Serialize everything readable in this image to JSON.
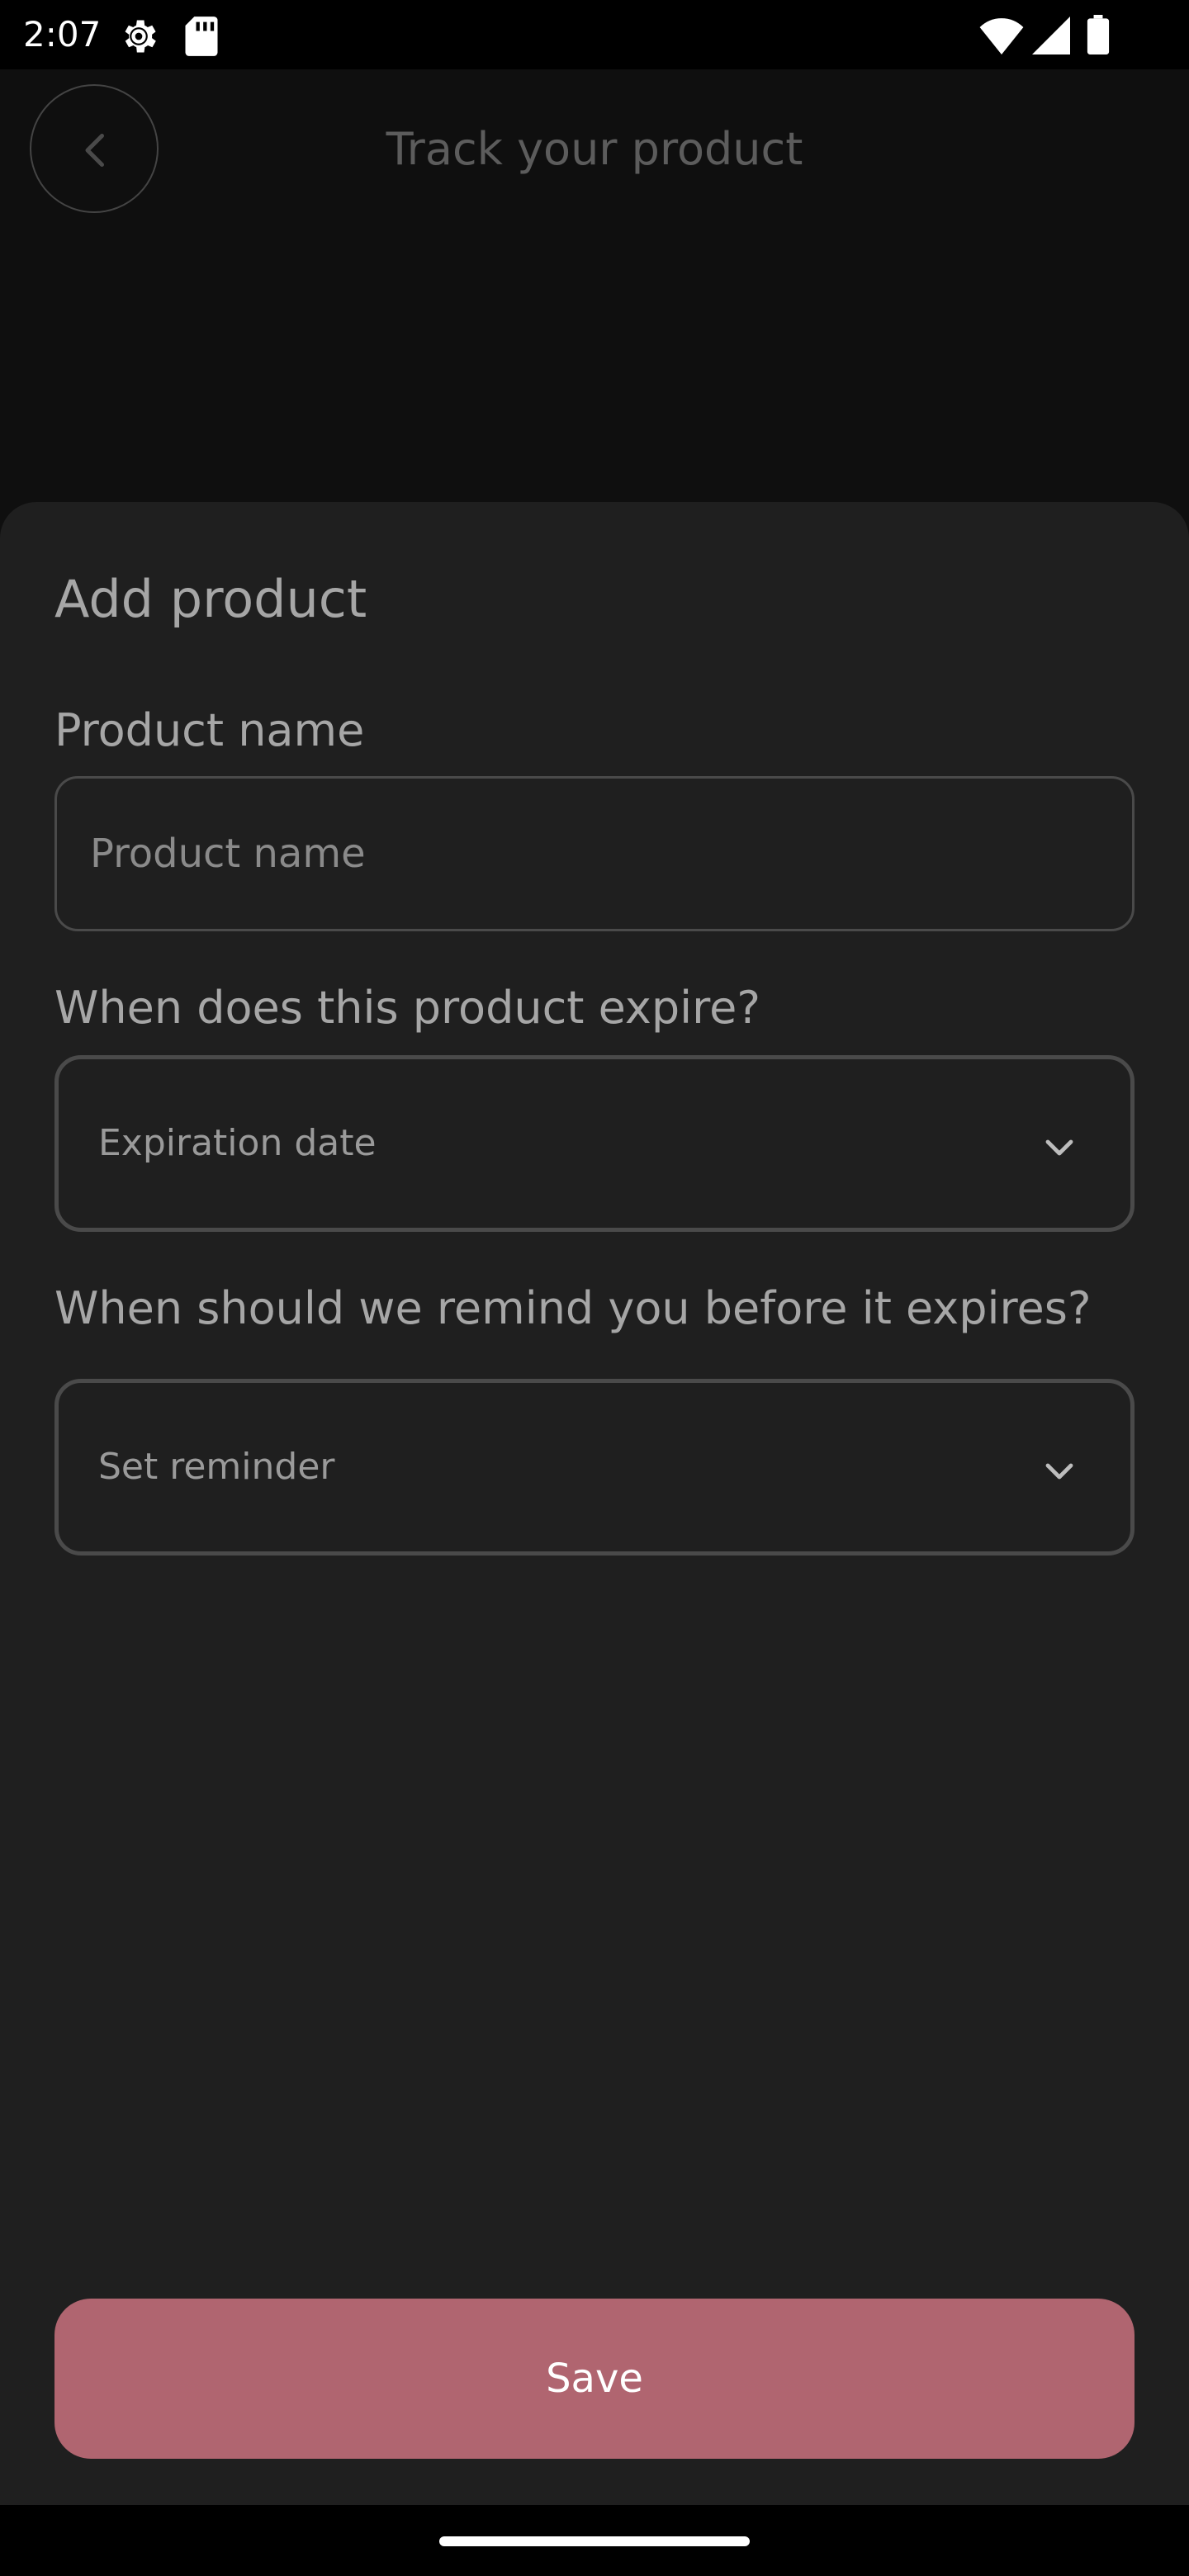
{
  "status_bar": {
    "time": "2:07",
    "icons": [
      "gear-icon",
      "sd-card-icon",
      "wifi-icon",
      "signal-icon",
      "battery-icon"
    ]
  },
  "header": {
    "title": "Track your product",
    "back_icon": "chevron-left-icon"
  },
  "sheet": {
    "title": "Add product",
    "product_name": {
      "label": "Product name",
      "placeholder": "Product name",
      "value": ""
    },
    "expiration": {
      "label": "When does this product expire?",
      "selected": "Expiration date"
    },
    "reminder": {
      "label": "When should we remind you before it expires?",
      "selected": "Set reminder"
    },
    "save_label": "Save"
  },
  "colors": {
    "accent": "#b06570",
    "sheet_background": "#1f1f1f",
    "border": "#4a4a4a"
  }
}
